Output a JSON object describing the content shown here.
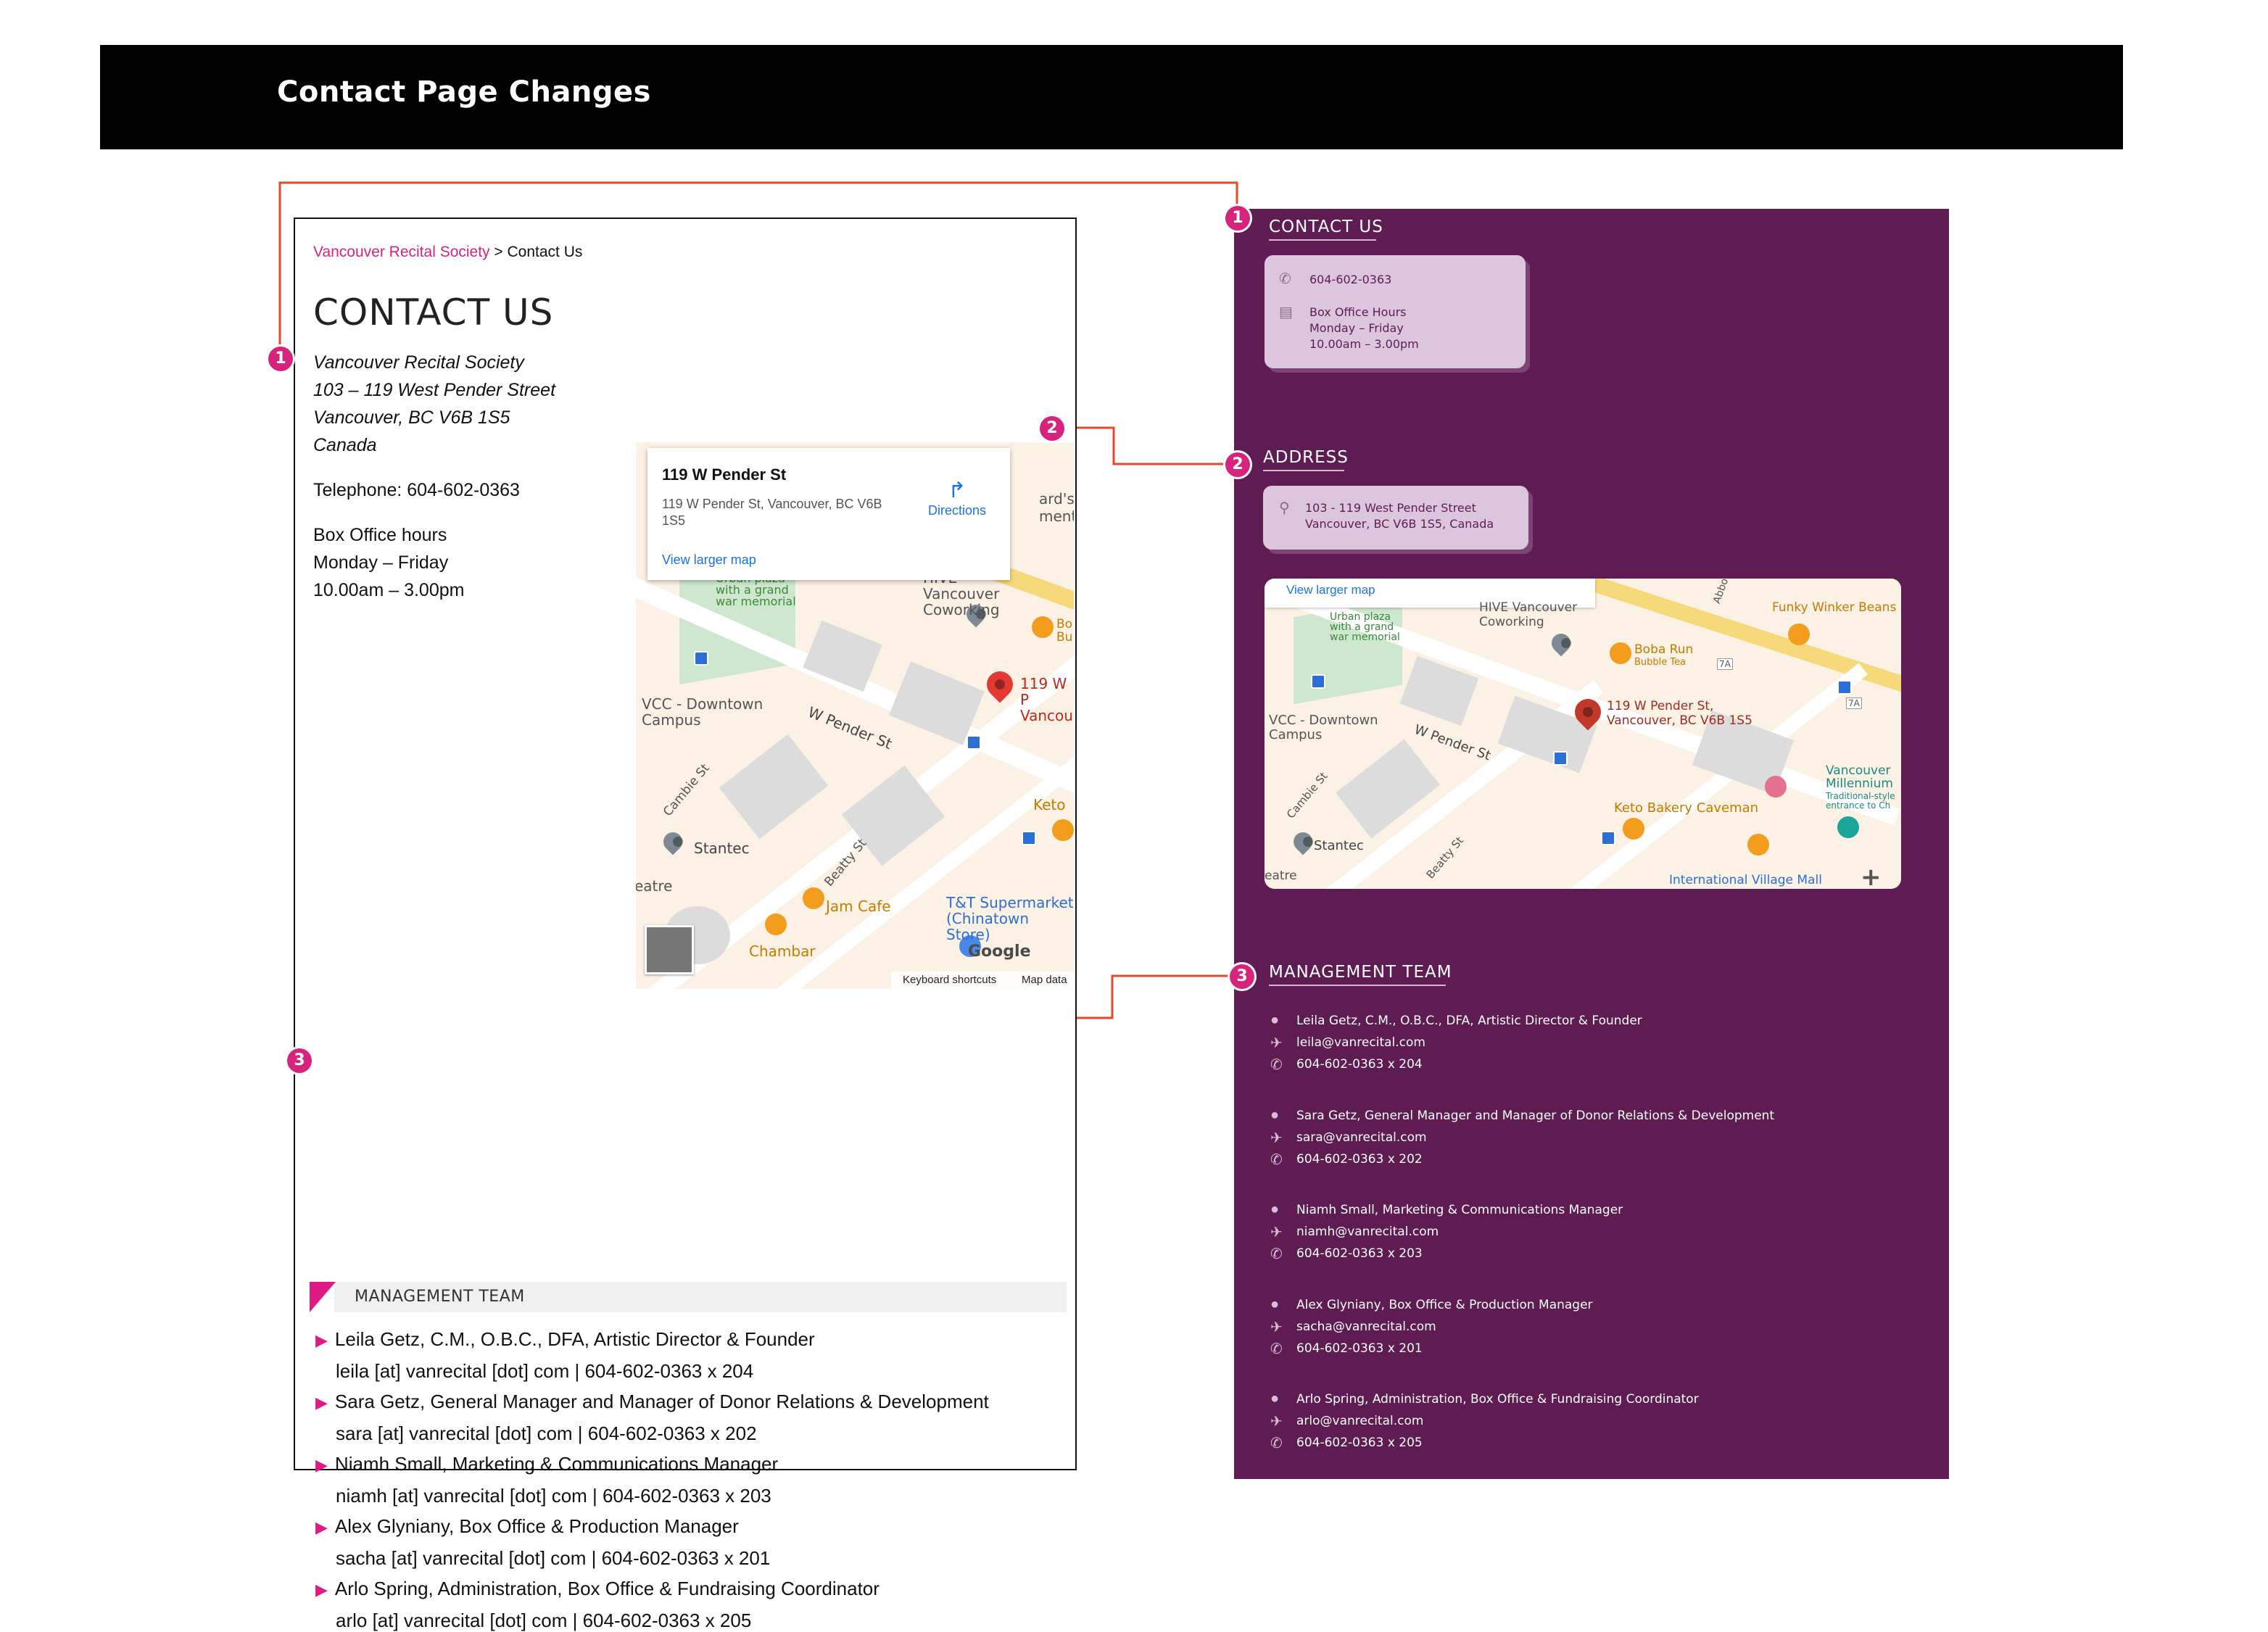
{
  "header": {
    "title": "Contact Page Changes"
  },
  "markers": [
    "1",
    "2",
    "3"
  ],
  "old_page": {
    "breadcrumb": {
      "home": "Vancouver Recital Society",
      "separator": " > ",
      "current": "Contact Us"
    },
    "title": "CONTACT US",
    "address": [
      "Vancouver Recital Society",
      "103 – 119 West Pender Street",
      "Vancouver, BC V6B 1S5",
      "Canada"
    ],
    "telephone": "Telephone: 604-602-0363",
    "hours": [
      "Box Office hours",
      "Monday – Friday",
      "10.00am – 3.00pm"
    ],
    "map": {
      "place_title": "119 W Pender St",
      "place_address": "119 W Pender St, Vancouver, BC V6B 1S5",
      "directions": "Directions",
      "view_larger": "View larger map",
      "footer": [
        "Keyboard shortcuts",
        "Map data"
      ],
      "labels": {
        "vcc": "VCC - Downtown Campus",
        "pender": "W Pender St",
        "cambie": "Cambie St",
        "stantec": "Stantec",
        "beatty": "Beatty St",
        "jam": "Jam Cafe",
        "chambar": "Chambar",
        "tt": "T&T Supermarket (Chinatown Store)",
        "keto": "Keto",
        "hive": "HIVE Vancouver Coworking",
        "urban": "Urban plaza with a grand war memorial",
        "pin": "119 W P Vancou",
        "theatre": "eatre",
        "bo": "Bo",
        "bu": "Bu",
        "ard": "ard's",
        "ment": "ment"
      },
      "logo": "Google"
    },
    "management": {
      "heading": "MANAGEMENT TEAM",
      "members": [
        {
          "name": "Leila Getz, C.M., O.B.C., DFA, Artistic Director & Founder",
          "contact": "leila [at] vanrecital [dot] com | 604-602-0363 x 204"
        },
        {
          "name": "Sara Getz, General Manager and Manager of Donor Relations & Development",
          "contact": "sara [at] vanrecital [dot] com | 604-602-0363 x 202"
        },
        {
          "name": "Niamh Small, Marketing & Communications Manager",
          "contact": "niamh [at] vanrecital [dot] com | 604-602-0363 x 203"
        },
        {
          "name": "Alex Glyniany, Box Office & Production Manager",
          "contact": "sacha [at] vanrecital [dot] com | 604-602-0363 x 201"
        },
        {
          "name": "Arlo Spring, Administration, Box Office & Fundraising Coordinator",
          "contact": "arlo [at] vanrecital [dot] com | 604-602-0363 x 205"
        }
      ]
    }
  },
  "new_page": {
    "contact": {
      "heading": "CONTACT US",
      "phone": "604-602-0363",
      "hours": [
        "Box Office Hours",
        "Monday – Friday",
        "10.00am – 3.00pm"
      ]
    },
    "address": {
      "heading": "ADDRESS",
      "lines": [
        "103 - 119 West Pender Street",
        "Vancouver, BC V6B 1S5, Canada"
      ]
    },
    "map": {
      "view_larger": "View larger map",
      "labels": {
        "hive": "HIVE Vancouver Coworking",
        "urban": "Urban plaza with a grand war memorial",
        "boba": "Boba Run",
        "boba_sub": "Bubble Tea",
        "funky": "Funky Winker Beans",
        "pin": "119 W Pender St, Vancouver, BC V6B 1S5",
        "vcc": "VCC - Downtown Campus",
        "pender": "W Pender St",
        "cambie": "Cambie St",
        "stantec": "Stantec",
        "beatty": "Beatty St",
        "keto": "Keto Bakery Caveman",
        "vm": "Vancouver Millennium",
        "vm_sub": "Traditional-style entrance to Ch",
        "ivm": "International Village Mall",
        "abbott": "Abbott",
        "theatre": "eatre",
        "r7a_1": "7A",
        "r7a_2": "7A"
      },
      "zoom": "+"
    },
    "management": {
      "heading": "MANAGEMENT TEAM",
      "members": [
        {
          "name": "Leila Getz, C.M., O.B.C., DFA, Artistic Director & Founder",
          "email": "leila@vanrecital.com",
          "phone": "604-602-0363 x 204"
        },
        {
          "name": "Sara Getz, General Manager and Manager of Donor Relations & Development",
          "email": "sara@vanrecital.com",
          "phone": "604-602-0363 x 202"
        },
        {
          "name": "Niamh Small, Marketing & Communications Manager",
          "email": "niamh@vanrecital.com",
          "phone": "604-602-0363 x 203"
        },
        {
          "name": "Alex Glyniany, Box Office & Production Manager",
          "email": "sacha@vanrecital.com",
          "phone": "604-602-0363 x 201"
        },
        {
          "name": "Arlo Spring, Administration, Box Office & Fundraising Coordinator",
          "email": "arlo@vanrecital.com",
          "phone": "604-602-0363 x 205"
        }
      ]
    }
  },
  "colors": {
    "accent": "#d6247d",
    "purple": "#5e1c52",
    "card": "#dbc6de",
    "connector": "#e8472b"
  }
}
